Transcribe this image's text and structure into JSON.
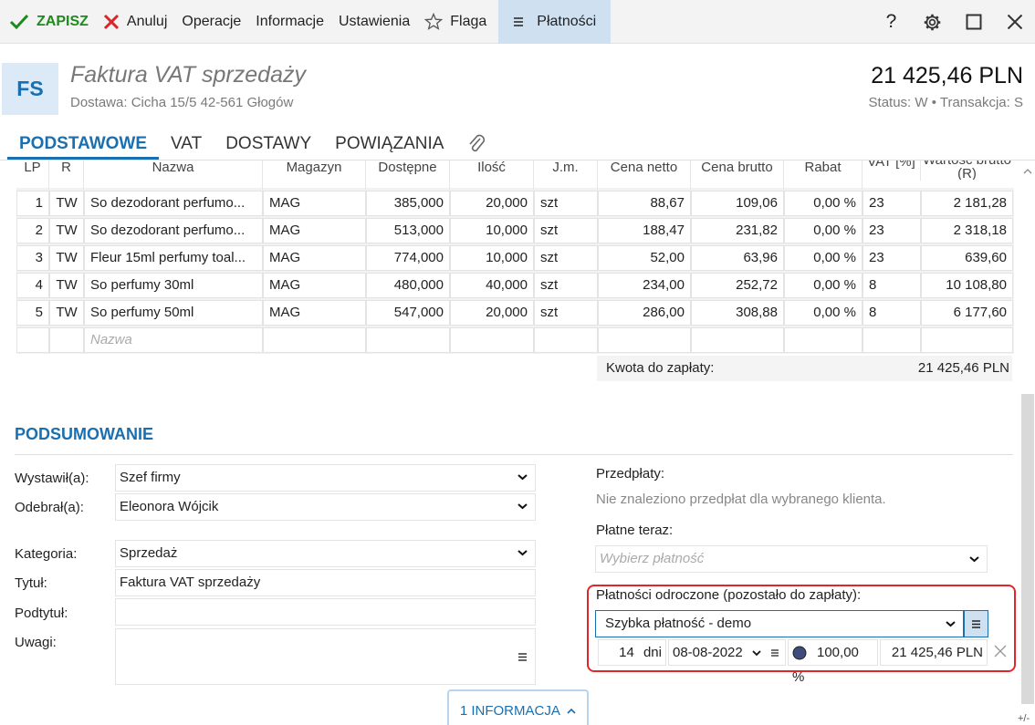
{
  "toolbar": {
    "save": "ZAPISZ",
    "cancel": "Anuluj",
    "operations": "Operacje",
    "information": "Informacje",
    "settings": "Ustawienia",
    "flag": "Flaga",
    "payments": "Płatności",
    "help": "?"
  },
  "document": {
    "badge": "FS",
    "title": "Faktura VAT sprzedaży",
    "delivery": "Dostawa: Cicha  15/5  42-561 Głogów",
    "amount": "21 425,46 PLN",
    "status": "Status:  W  •  Transakcja:  S"
  },
  "tabs": [
    "PODSTAWOWE",
    "VAT",
    "DOSTAWY",
    "POWIĄZANIA"
  ],
  "table": {
    "columns": [
      "LP",
      "R",
      "Nazwa",
      "Magazyn",
      "Dostępne",
      "Ilość",
      "J.m.",
      "Cena netto",
      "Cena brutto",
      "Rabat",
      "VAT [%]",
      "Wartość brutto (R)"
    ],
    "rows": [
      [
        "1",
        "TW",
        "So dezodorant perfumo...",
        "MAG",
        "385,000",
        "20,000",
        "szt",
        "88,67",
        "109,06",
        "0,00 %",
        "23",
        "2 181,28"
      ],
      [
        "2",
        "TW",
        "So dezodorant perfumo...",
        "MAG",
        "513,000",
        "10,000",
        "szt",
        "188,47",
        "231,82",
        "0,00 %",
        "23",
        "2 318,18"
      ],
      [
        "3",
        "TW",
        "Fleur 15ml perfumy toal...",
        "MAG",
        "774,000",
        "10,000",
        "szt",
        "52,00",
        "63,96",
        "0,00 %",
        "23",
        "639,60"
      ],
      [
        "4",
        "TW",
        "So perfumy 30ml",
        "MAG",
        "480,000",
        "40,000",
        "szt",
        "234,00",
        "252,72",
        "0,00 %",
        "8",
        "10 108,80"
      ],
      [
        "5",
        "TW",
        "So perfumy 50ml",
        "MAG",
        "547,000",
        "20,000",
        "szt",
        "286,00",
        "308,88",
        "0,00 %",
        "8",
        "6 177,60"
      ]
    ],
    "new_row_placeholder": "Nazwa",
    "total_label": "Kwota do zapłaty:",
    "total_value": "21 425,46 PLN"
  },
  "summary": {
    "title": "PODSUMOWANIE",
    "issued_label": "Wystawił(a):",
    "issued_value": "Szef firmy",
    "received_label": "Odebrał(a):",
    "received_value": "Eleonora Wójcik",
    "category_label": "Kategoria:",
    "category_value": "Sprzedaż",
    "title_label": "Tytuł:",
    "title_value": "Faktura VAT sprzedaży",
    "subtitle_label": "Podtytuł:",
    "subtitle_value": "",
    "notes_label": "Uwagi:",
    "notes_value": ""
  },
  "payments": {
    "prepayments_label": "Przedpłaty:",
    "prepayments_message": "Nie znaleziono przedpłat dla wybranego klienta.",
    "pay_now_label": "Płatne teraz:",
    "pay_now_placeholder": "Wybierz płatność",
    "deferred_label": "Płatności odroczone (pozostało do zapłaty):",
    "deferred_method": "Szybka płatność - demo",
    "days": "14",
    "days_unit": "dni",
    "due_date": "08-08-2022",
    "percent": "100,00 %",
    "amount": "21 425,46 PLN"
  },
  "info_button": "1 INFORMACJA",
  "plus_minus": "+/-",
  "colors": {
    "accent": "#1a6fb0",
    "save_green": "#1e8a1e",
    "cancel_red": "#d9262b",
    "highlight_frame": "#e0262b",
    "payments_tab_bg": "#cfe1f1"
  }
}
